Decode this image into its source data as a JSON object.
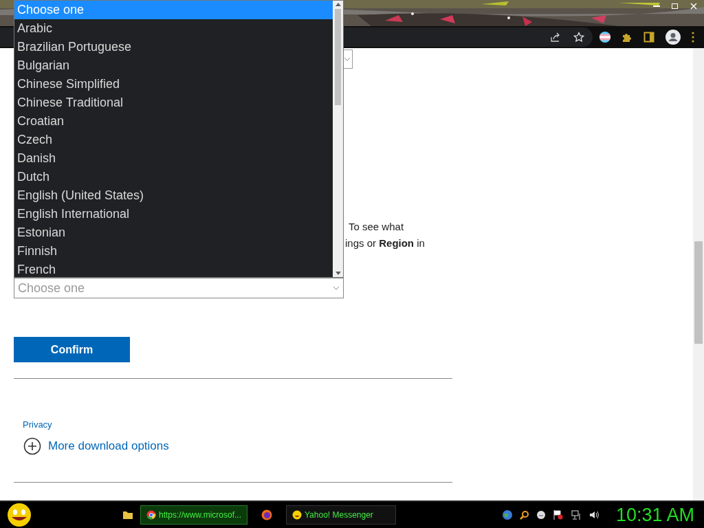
{
  "dropdown": {
    "options": [
      {
        "label": "Choose one",
        "selected": true
      },
      {
        "label": "Arabic",
        "selected": false
      },
      {
        "label": "Brazilian Portuguese",
        "selected": false
      },
      {
        "label": "Bulgarian",
        "selected": false
      },
      {
        "label": "Chinese Simplified",
        "selected": false
      },
      {
        "label": "Chinese Traditional",
        "selected": false
      },
      {
        "label": "Croatian",
        "selected": false
      },
      {
        "label": "Czech",
        "selected": false
      },
      {
        "label": "Danish",
        "selected": false
      },
      {
        "label": "Dutch",
        "selected": false
      },
      {
        "label": "English (United States)",
        "selected": false
      },
      {
        "label": "English International",
        "selected": false
      },
      {
        "label": "Estonian",
        "selected": false
      },
      {
        "label": "Finnish",
        "selected": false
      },
      {
        "label": "French",
        "selected": false
      }
    ]
  },
  "page": {
    "text_lines": [
      "To see what",
      "ings or **Region** in"
    ],
    "select": {
      "placeholder": "Choose one"
    },
    "confirm_button": "Confirm",
    "privacy_link": "Privacy",
    "more_options": "More download options"
  },
  "taskbar": {
    "tasks": [
      {
        "kind": "browser",
        "label": "https://www.microsof..."
      },
      {
        "kind": "messenger",
        "label": "Yahoo! Messenger"
      }
    ],
    "clock": "10:31 AM"
  }
}
